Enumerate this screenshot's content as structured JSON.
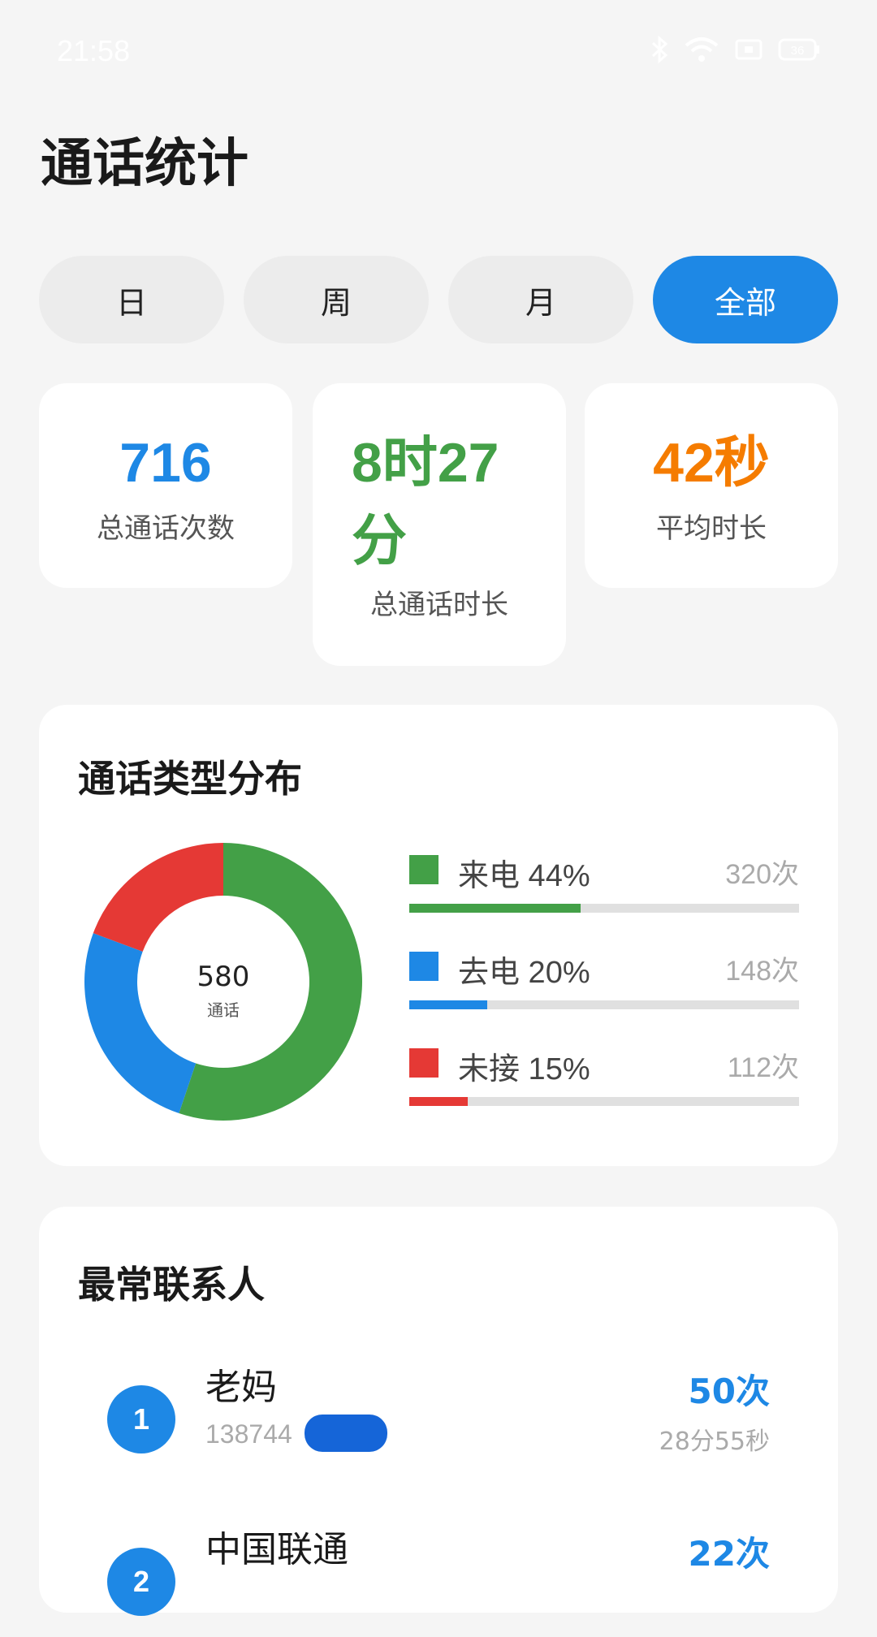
{
  "status_bar": {
    "time": "21:58",
    "battery": "36"
  },
  "page": {
    "title": "通话统计"
  },
  "tabs": [
    {
      "label": "日",
      "active": false
    },
    {
      "label": "周",
      "active": false
    },
    {
      "label": "月",
      "active": false
    },
    {
      "label": "全部",
      "active": true
    }
  ],
  "stats": {
    "total_calls": {
      "value": "716",
      "label": "总通话次数"
    },
    "total_duration": {
      "value_line1": "8时27",
      "value_line2": "分",
      "label": "总通话时长"
    },
    "avg_duration": {
      "value": "42秒",
      "label": "平均时长"
    }
  },
  "distribution": {
    "title": "通话类型分布",
    "center_value": "580",
    "center_label": "通话",
    "items": [
      {
        "label": "来电 44%",
        "count": "320次",
        "color": "#43a047",
        "percent": 44
      },
      {
        "label": "去电 20%",
        "count": "148次",
        "color": "#1e88e5",
        "percent": 20
      },
      {
        "label": "未接 15%",
        "count": "112次",
        "color": "#e53935",
        "percent": 15
      }
    ]
  },
  "chart_data": {
    "type": "pie",
    "title": "",
    "categories": [
      "来电",
      "去电",
      "未接"
    ],
    "values": [
      320,
      148,
      112
    ],
    "colors": [
      "#43a047",
      "#1e88e5",
      "#e53935"
    ]
  },
  "contacts": {
    "title": "最常联系人",
    "items": [
      {
        "rank": "1",
        "name": "老妈",
        "number": "138744",
        "count": "50次",
        "duration": "28分55秒"
      },
      {
        "rank": "2",
        "name": "中国联通",
        "number": "",
        "count": "22次",
        "duration": ""
      }
    ]
  }
}
